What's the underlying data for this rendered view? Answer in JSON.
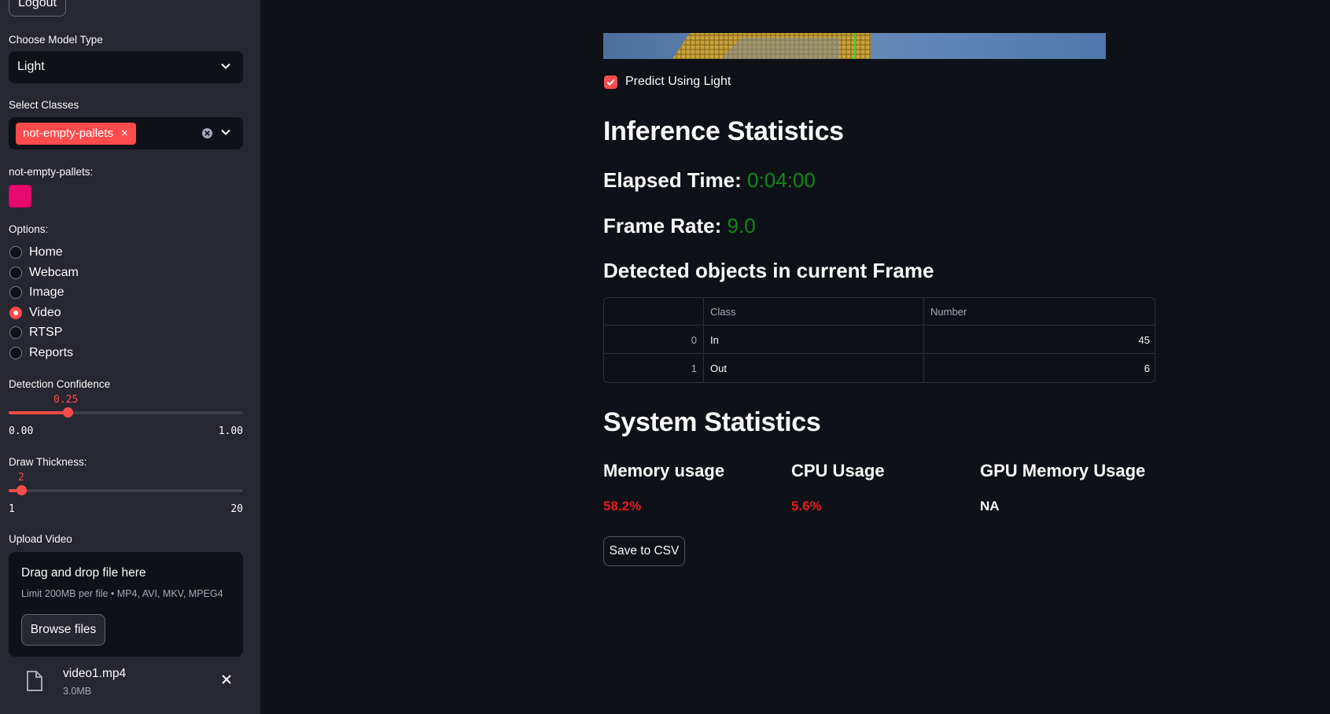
{
  "sidebar": {
    "logout_label": "Logout",
    "model_type": {
      "label": "Choose Model Type",
      "value": "Light"
    },
    "classes": {
      "label": "Select Classes",
      "selected_tag": "not-empty-pallets",
      "tag_remove": "×"
    },
    "color_picker": {
      "label": "not-empty-pallets:",
      "color": "#e6096e"
    },
    "options": {
      "label": "Options:",
      "items": [
        "Home",
        "Webcam",
        "Image",
        "Video",
        "RTSP",
        "Reports"
      ],
      "selected": "Video"
    },
    "confidence": {
      "label": "Detection Confidence",
      "value": "0.25",
      "min": "0.00",
      "max": "1.00",
      "fraction": 0.25
    },
    "thickness": {
      "label": "Draw Thickness:",
      "value": "2",
      "min": "1",
      "max": "20",
      "fraction": 0.0526
    },
    "upload": {
      "label": "Upload Video",
      "title": "Drag and drop file here",
      "limit": "Limit 200MB per file • MP4, AVI, MKV, MPEG4",
      "browse_label": "Browse files",
      "file_name": "video1.mp4",
      "file_size": "3.0MB"
    }
  },
  "main": {
    "predict_checkbox": {
      "label": "Predict Using Light",
      "checked": true
    },
    "inference_title": "Inference Statistics",
    "elapsed": {
      "label": "Elapsed Time:",
      "value": "0:04:00"
    },
    "frame_rate": {
      "label": "Frame Rate:",
      "value": "9.0"
    },
    "detected_title": "Detected objects in current Frame",
    "table": {
      "columns": [
        "",
        "Class",
        "Number"
      ],
      "rows": [
        {
          "index": "0",
          "class": "In",
          "number": "45"
        },
        {
          "index": "1",
          "class": "Out",
          "number": "6"
        }
      ]
    },
    "system_title": "System Statistics",
    "memory": {
      "label": "Memory usage",
      "value": "58.2%"
    },
    "cpu": {
      "label": "CPU Usage",
      "value": "5.6%"
    },
    "gpu": {
      "label": "GPU Memory Usage",
      "value": "NA"
    },
    "save_csv_label": "Save to CSV"
  },
  "colors": {
    "accent": "#ff4b4b",
    "sidebar_bg": "#262730",
    "main_bg": "#0e1117",
    "green_value": "#0f8a1a",
    "red_value": "#e41c1c"
  }
}
